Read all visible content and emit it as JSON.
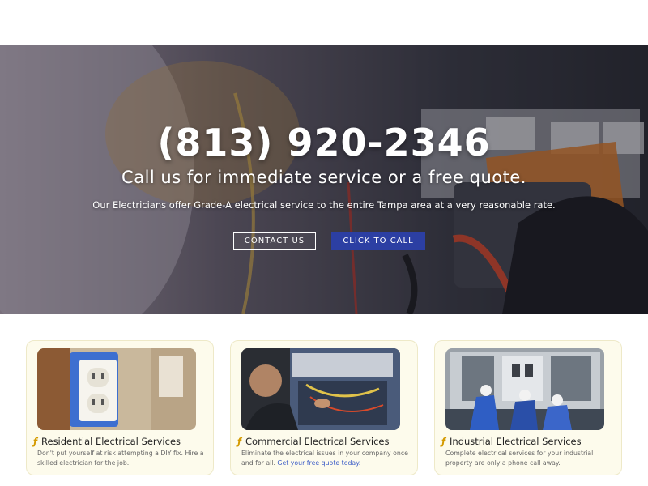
{
  "hero": {
    "phone": "(813) 920-2346",
    "subtitle": "Call us for immediate service or a free quote.",
    "description": "Our Electricians offer Grade-A electrical service to the entire Tampa area at a very reasonable rate.",
    "contact_button": "CONTACT US",
    "call_button": "CLICK TO CALL"
  },
  "services": [
    {
      "title": "Residential Electrical Services",
      "text": "Don't put yourself at risk attempting a DIY fix. Hire a skilled electrician for the job.",
      "link": ""
    },
    {
      "title": "Commercial Electrical Services",
      "text": "Eliminate the electrical issues in your company once and for all.",
      "link": "Get your free quote today."
    },
    {
      "title": "Industrial Electrical Services",
      "text": "Complete electrical services for your industrial property are only a phone call away.",
      "link": ""
    }
  ],
  "colors": {
    "accent_button": "#2c3fa3",
    "card_background": "#fdfbec",
    "link": "#3a5bc7",
    "bolt_icon": "#d49a00"
  },
  "icons": [
    "lightning-bolt-icon"
  ]
}
